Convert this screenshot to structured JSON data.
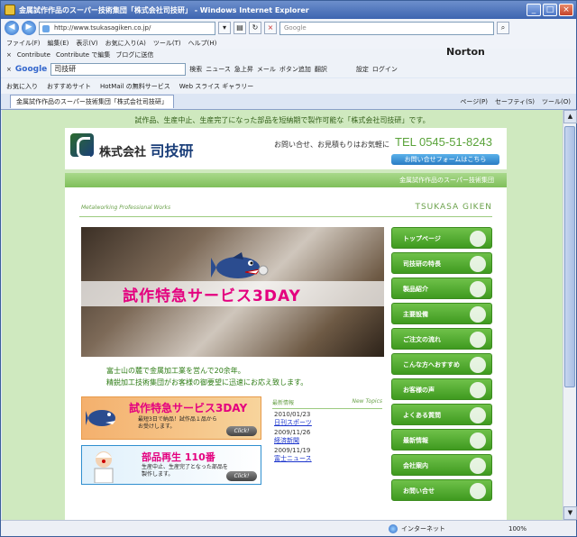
{
  "window": {
    "title": "金属試作作品のスーパー技術集団「株式会社司技研」 - Windows Internet Explorer",
    "controls": [
      "_",
      "□",
      "×"
    ]
  },
  "address_bar": {
    "url": "http://www.tsukasagiken.co.jp/",
    "search_placeholder": "Google"
  },
  "menu": [
    "ファイル(F)",
    "編集(E)",
    "表示(V)",
    "お気に入り(A)",
    "ツール(T)",
    "ヘルプ(H)"
  ],
  "contribute_bar": {
    "items": [
      "Contribute",
      "Contribute で編集",
      "ブログに送信"
    ],
    "norton": "Norton"
  },
  "google_bar": {
    "logo": "Google",
    "query": "司技研",
    "buttons": [
      "検索",
      "ニュース",
      "急上昇",
      "メール",
      "ボタン追加",
      "翻訳"
    ],
    "right": [
      "設定",
      "ログイン"
    ]
  },
  "favorites_bar": {
    "items": [
      "お気に入り",
      "おすすめサイト",
      "HotMail の無料サービス",
      "Web スライス ギャラリー"
    ]
  },
  "tab": {
    "title": "金属試作作品のスーパー技術集団「株式会社司技研」"
  },
  "command_bar": [
    "ページ(P)",
    "セーフティ(S)",
    "ツール(O)"
  ],
  "page": {
    "tagline": "試作品、生産中止、生産完了になった部品を短納期で製作可能な「株式会社司技研」です。",
    "company_prefix": "株式会社",
    "company_name": "司技研",
    "contact_text": "お問い合せ、お見積もりはお気軽に",
    "tel": "TEL 0545-51-8243",
    "form_button": "お問い合せフォームはこちら",
    "catch": "金属試作作品のスーパー技術集団",
    "sub_left": "Metalworking Professional Works",
    "sub_right": "TSUKASA GIKEN",
    "hero_title": "試作特急サービス3DAY",
    "intro_line1": "富士山の麓で金属加工業を営んで20余年。",
    "intro_line2": "精鋭加工技術集団がお客様の御要望に迅速にお応え致します。",
    "promo1": {
      "title": "試作特急サービス3DAY",
      "desc1": "最短3日で納品！試作品１品から",
      "desc2": "お受けします。",
      "click": "Click!"
    },
    "promo2": {
      "title": "部品再生 110番",
      "desc1": "生産中止、生産完了となった部品を",
      "desc2": "製作します。",
      "click": "Click!"
    },
    "news": {
      "header": "最新情報",
      "new_topics": "New Topics",
      "items": [
        {
          "date": "2010/01/23",
          "link": "日刊スポーツ"
        },
        {
          "date": "2009/11/26",
          "link": "経済新聞"
        },
        {
          "date": "2009/11/19",
          "link": "富士ニュース"
        }
      ]
    },
    "nav": [
      "トップページ",
      "司技研の特長",
      "製品紹介",
      "主要設備",
      "ご注文の流れ",
      "こんな方へおすすめ",
      "お客様の声",
      "よくある質問",
      "最新情報",
      "会社案内",
      "お問い合せ"
    ]
  },
  "status": {
    "zone": "インターネット",
    "zoom": "100%"
  },
  "colors": {
    "page_bg": "#cfe9bf",
    "accent_green": "#5aa33a",
    "hero_title": "#e4007f"
  }
}
